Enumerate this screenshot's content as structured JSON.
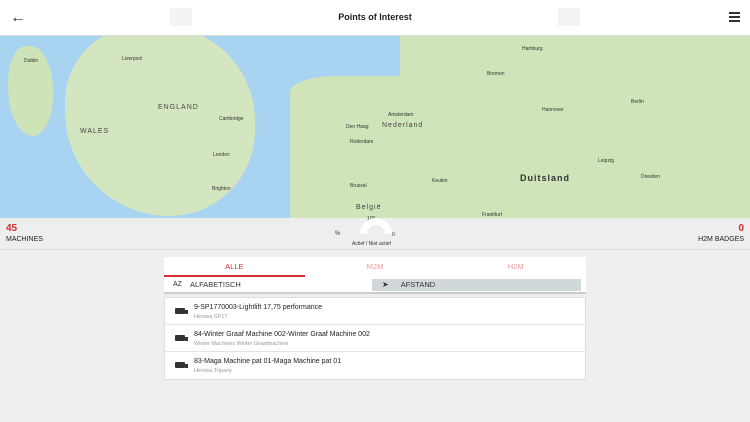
{
  "header": {
    "title": "Points of Interest"
  },
  "map": {
    "labels": {
      "dublin": "Dublin",
      "liverpool": "Liverpool",
      "england": "ENGLAND",
      "wales": "WALES",
      "london": "London",
      "cambridge": "Cambridge",
      "brighton": "Brighton",
      "amsterdam": "Amsterdam",
      "den_haag": "Den Haag",
      "rotterdam": "Rotterdam",
      "nederland": "Nederland",
      "belgie": "België",
      "brussel": "Brussel",
      "hamburg": "Hamburg",
      "bremen": "Bremen",
      "hannover": "Hannover",
      "berlin": "Berlin",
      "duitsland": "Duitsland",
      "keulen": "Keulen",
      "frankfurt": "Frankfurt",
      "leipzig": "Leipzig",
      "dresden": "Dresden"
    }
  },
  "stats": {
    "machines_count": "45",
    "machines_label": "MACHINES",
    "percent": "%",
    "gauge_max": "100",
    "gauge_min": "0",
    "gauge_label": "Actief / Niet actief",
    "badges_count": "0",
    "badges_label": "H2M BADGES"
  },
  "tabs": [
    "ALLE",
    "M2M",
    "H2M"
  ],
  "sort": {
    "alpha": "ALFABETISCH",
    "alpha_icon": "AZ",
    "distance": "AFSTAND"
  },
  "items": [
    {
      "title": "9-SP1770003-Lightlift 17,75 performance",
      "subtitle": "Hinowa SP17"
    },
    {
      "title": "84-Winter Graaf Machine 002-Winter Graaf Machine 002",
      "subtitle": "Winter Machines Winter Graafmachine"
    },
    {
      "title": "83-Maga Machine pat 01-Maga Machine pat 01",
      "subtitle": "Hinowa Tripany"
    }
  ]
}
